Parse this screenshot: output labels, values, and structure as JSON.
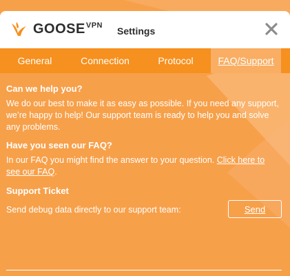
{
  "app": {
    "brand": "GOOSE",
    "brand_suffix": "VPN",
    "window_title": "Settings"
  },
  "colors": {
    "background": "#f7a04a",
    "tab_bar": "#f6901e",
    "active_tab": "#f9ae63",
    "text": "#ffffff",
    "titlebar": "#ffffff"
  },
  "icons": {
    "logo": "goose-logo-icon",
    "close": "close-icon"
  },
  "tabs": [
    {
      "label": "General",
      "active": false
    },
    {
      "label": "Connection",
      "active": false
    },
    {
      "label": "Protocol",
      "active": false
    },
    {
      "label": "FAQ/Support",
      "active": true
    }
  ],
  "faq": {
    "help_heading": "Can we help you?",
    "help_text": "We do our best to make it as easy as possible. If you need any support, we’re happy to help! Our support team is ready to help you and solve any problems.",
    "faq_heading": "Have you seen our FAQ?",
    "faq_text": "In our FAQ you might find the answer to your question.",
    "faq_link": "Click here to see our FAQ",
    "faq_link_end": ".",
    "ticket_heading": "Support Ticket",
    "ticket_text": "Send debug data directly to our support team:",
    "send_label": "Send"
  }
}
